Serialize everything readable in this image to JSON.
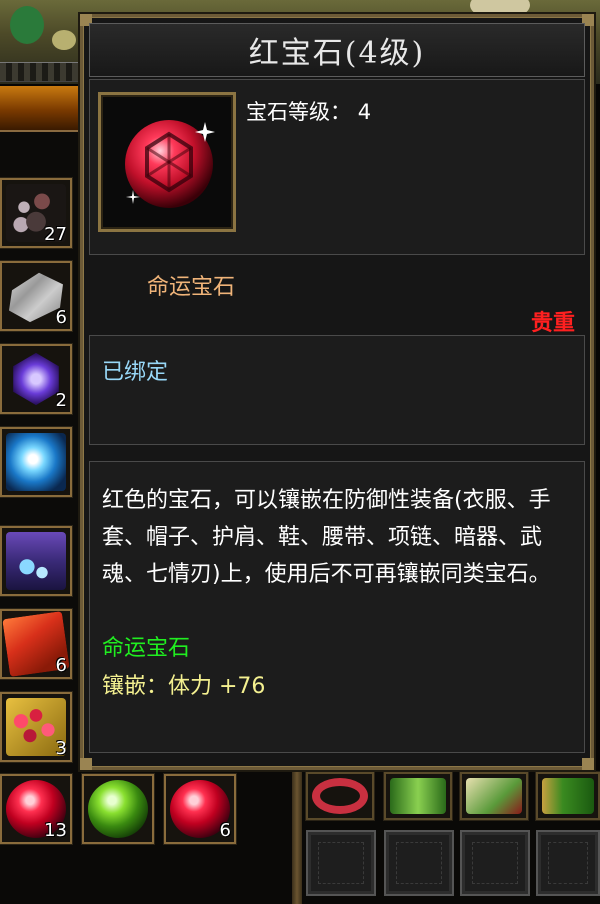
{
  "tooltip": {
    "title": "红宝石(4级)",
    "gem_level_label": "宝石等级：",
    "gem_level_value": "4",
    "category": "命运宝石",
    "rarity": "贵重",
    "bind_status": "已绑定",
    "description": "红色的宝石，可以镶嵌在防御性装备(衣服、手套、帽子、护肩、鞋、腰带、项链、暗器、武魂、七情刃)上，使用后不可再镶嵌同类宝石。",
    "effect_name": "命运宝石",
    "effect_stat": "镶嵌：体力 +76"
  },
  "inventory_left": [
    {
      "icon": "ore-chunks-icon",
      "qty": "27"
    },
    {
      "icon": "silver-ingot-icon",
      "qty": "6"
    },
    {
      "icon": "purple-crystal-icon",
      "qty": "2"
    },
    {
      "icon": "blue-crystal-icon",
      "qty": ""
    },
    {
      "icon": "jewel-box-icon",
      "qty": ""
    },
    {
      "icon": "red-stone-icon",
      "qty": "6"
    },
    {
      "icon": "berries-icon",
      "qty": "3"
    }
  ],
  "inventory_bottom": [
    {
      "icon": "red-gem-icon",
      "qty": "13"
    },
    {
      "icon": "green-gem-icon",
      "qty": ""
    },
    {
      "icon": "red-gem-icon",
      "qty": "6"
    }
  ],
  "colors": {
    "title": "#e8e8e8",
    "category": "#f0b479",
    "rarity": "#ff2020",
    "bind": "#98d8f8",
    "effect_name": "#20ee20",
    "effect_stat": "#f4f090"
  }
}
